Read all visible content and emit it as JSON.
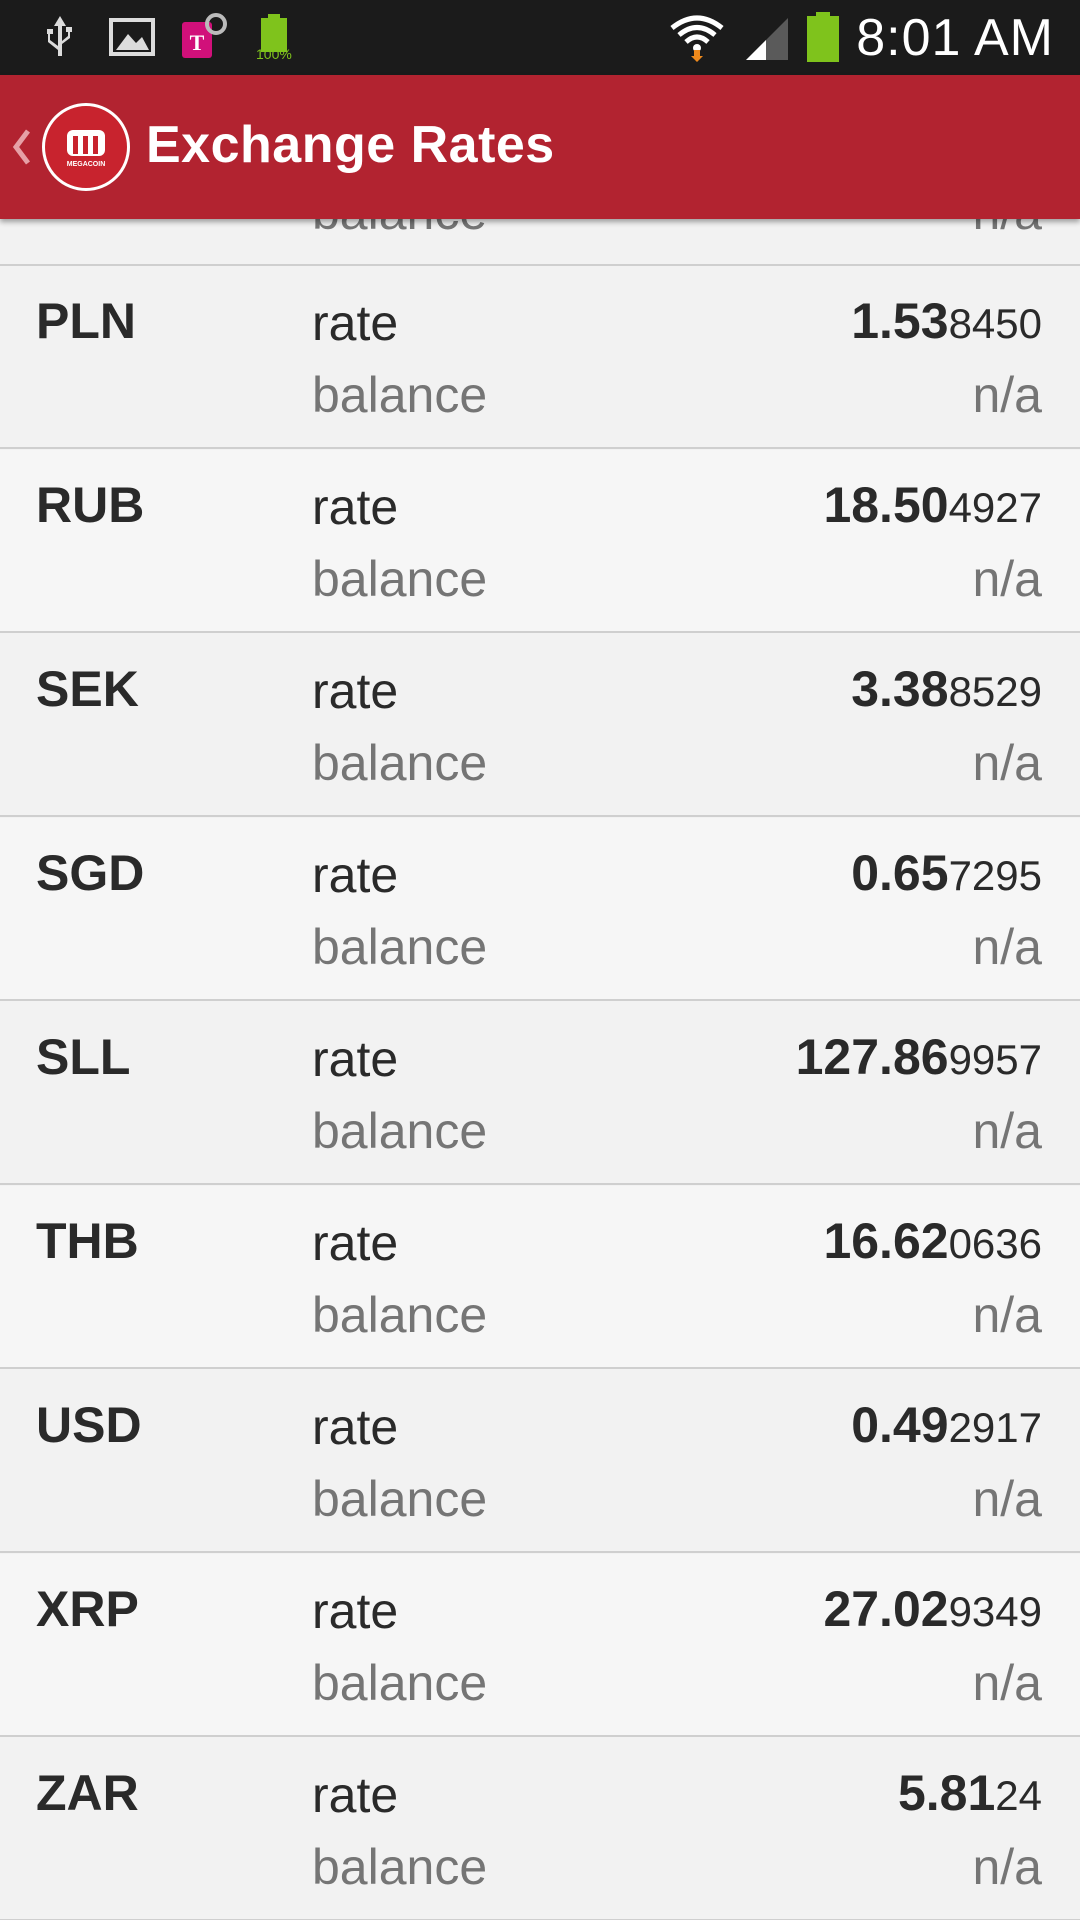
{
  "status_bar": {
    "time": "8:01 AM",
    "battery_percent": "100%",
    "icons": [
      "usb-icon",
      "image-icon",
      "t-mobile-icon",
      "battery-notification-icon",
      "wifi-icon",
      "signal-icon",
      "battery-icon"
    ]
  },
  "app_bar": {
    "title": "Exchange Rates",
    "logo_text": "MEGACOIN",
    "accent_color": "#b22330"
  },
  "list": {
    "partial_top_row": {
      "balance_label": "balance",
      "balance_value": "n/a"
    },
    "rows": [
      {
        "code": "PLN",
        "rate_label": "rate",
        "rate_major": "1.53",
        "rate_minor": "8450",
        "balance_label": "balance",
        "balance_value": "n/a"
      },
      {
        "code": "RUB",
        "rate_label": "rate",
        "rate_major": "18.50",
        "rate_minor": "4927",
        "balance_label": "balance",
        "balance_value": "n/a"
      },
      {
        "code": "SEK",
        "rate_label": "rate",
        "rate_major": "3.38",
        "rate_minor": "8529",
        "balance_label": "balance",
        "balance_value": "n/a"
      },
      {
        "code": "SGD",
        "rate_label": "rate",
        "rate_major": "0.65",
        "rate_minor": "7295",
        "balance_label": "balance",
        "balance_value": "n/a"
      },
      {
        "code": "SLL",
        "rate_label": "rate",
        "rate_major": "127.86",
        "rate_minor": "9957",
        "balance_label": "balance",
        "balance_value": "n/a"
      },
      {
        "code": "THB",
        "rate_label": "rate",
        "rate_major": "16.62",
        "rate_minor": "0636",
        "balance_label": "balance",
        "balance_value": "n/a"
      },
      {
        "code": "USD",
        "rate_label": "rate",
        "rate_major": "0.49",
        "rate_minor": "2917",
        "balance_label": "balance",
        "balance_value": "n/a"
      },
      {
        "code": "XRP",
        "rate_label": "rate",
        "rate_major": "27.02",
        "rate_minor": "9349",
        "balance_label": "balance",
        "balance_value": "n/a"
      },
      {
        "code": "ZAR",
        "rate_label": "rate",
        "rate_major": "5.81",
        "rate_minor": "24",
        "balance_label": "balance",
        "balance_value": "n/a"
      }
    ]
  }
}
